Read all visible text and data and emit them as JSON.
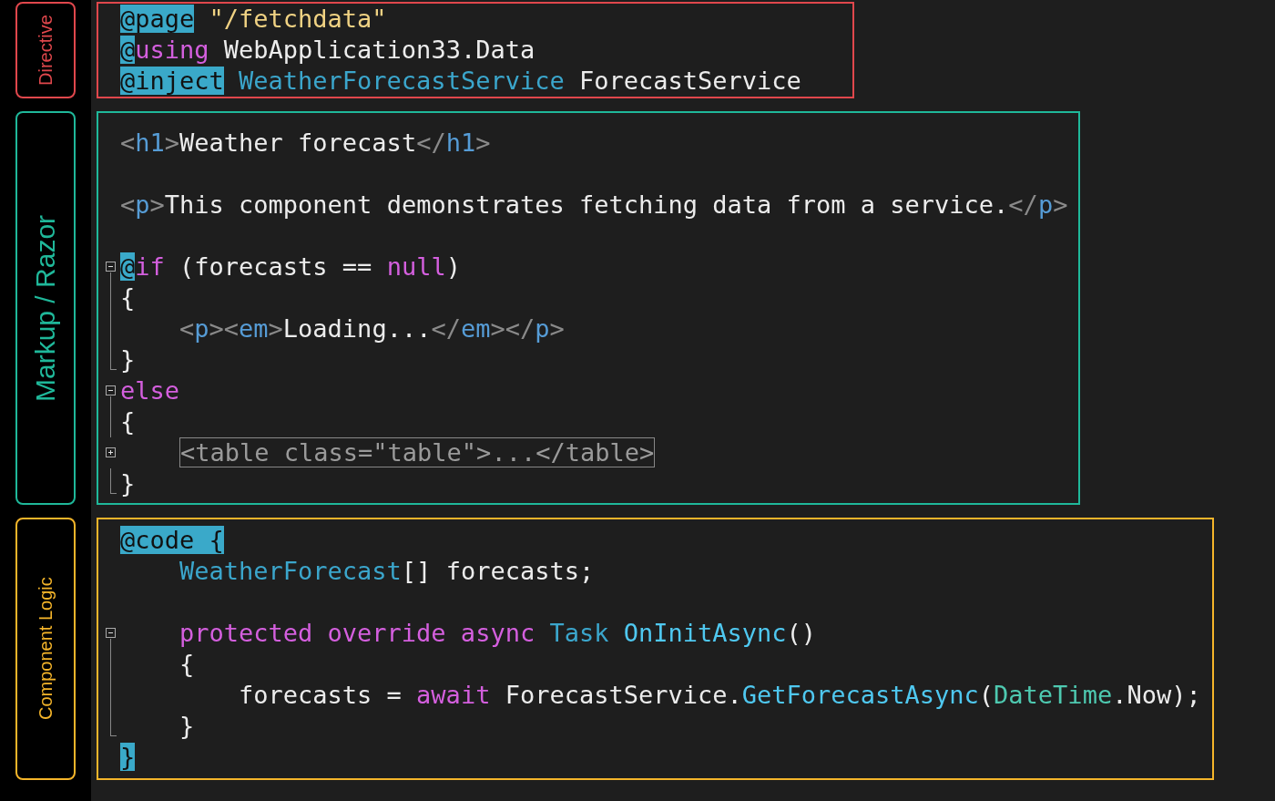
{
  "sections": [
    {
      "label": "Directive",
      "kind": "directive",
      "color": "#e0474c",
      "lines": [
        {
          "kind": "plain",
          "tokens": [
            {
              "kind": "razor",
              "text": "@page"
            },
            {
              "kind": "string",
              "text": " \"/fetchdata\""
            }
          ]
        },
        {
          "kind": "plain",
          "tokens": [
            {
              "kind": "razor",
              "text": "@"
            },
            {
              "kind": "keyword",
              "text": "using"
            },
            {
              "kind": "text",
              "text": " WebApplication33.Data"
            }
          ]
        },
        {
          "kind": "plain",
          "tokens": [
            {
              "kind": "razor",
              "text": "@inject"
            },
            {
              "kind": "type",
              "text": " WeatherForecastService"
            },
            {
              "kind": "text",
              "text": " ForecastService"
            }
          ]
        }
      ]
    },
    {
      "label": "Markup / Razor",
      "kind": "markup",
      "color": "#1fb89a",
      "lines": [
        {
          "kind": "plain",
          "tokens": [
            {
              "kind": "punct",
              "text": "<"
            },
            {
              "kind": "tag",
              "text": "h1"
            },
            {
              "kind": "punct",
              "text": ">"
            },
            {
              "kind": "text",
              "text": "Weather forecast"
            },
            {
              "kind": "punct",
              "text": "</"
            },
            {
              "kind": "tag",
              "text": "h1"
            },
            {
              "kind": "punct",
              "text": ">"
            }
          ]
        },
        {
          "kind": "blank"
        },
        {
          "kind": "plain",
          "tokens": [
            {
              "kind": "punct",
              "text": "<"
            },
            {
              "kind": "tag",
              "text": "p"
            },
            {
              "kind": "punct",
              "text": ">"
            },
            {
              "kind": "text",
              "text": "This component demonstrates fetching data from a service."
            },
            {
              "kind": "punct",
              "text": "</"
            },
            {
              "kind": "tag",
              "text": "p"
            },
            {
              "kind": "punct",
              "text": ">"
            }
          ]
        },
        {
          "kind": "blank"
        },
        {
          "kind": "fold_start",
          "tokens": [
            {
              "kind": "razor",
              "text": "@"
            },
            {
              "kind": "keyword",
              "text": "if"
            },
            {
              "kind": "text",
              "text": " (forecasts == "
            },
            {
              "kind": "keyword",
              "text": "null"
            },
            {
              "kind": "text",
              "text": ")"
            }
          ]
        },
        {
          "kind": "fold_body",
          "tokens": [
            {
              "kind": "text",
              "text": "{"
            }
          ]
        },
        {
          "kind": "fold_body",
          "tokens": [
            {
              "kind": "punct",
              "text": "    <"
            },
            {
              "kind": "tag",
              "text": "p"
            },
            {
              "kind": "punct",
              "text": "><"
            },
            {
              "kind": "tag",
              "text": "em"
            },
            {
              "kind": "punct",
              "text": ">"
            },
            {
              "kind": "text",
              "text": "Loading..."
            },
            {
              "kind": "punct",
              "text": "</"
            },
            {
              "kind": "tag",
              "text": "em"
            },
            {
              "kind": "punct",
              "text": "></"
            },
            {
              "kind": "tag",
              "text": "p"
            },
            {
              "kind": "punct",
              "text": ">"
            }
          ]
        },
        {
          "kind": "fold_end",
          "tokens": [
            {
              "kind": "text",
              "text": "}"
            }
          ]
        },
        {
          "kind": "fold_start",
          "tokens": [
            {
              "kind": "keyword",
              "text": "else"
            }
          ]
        },
        {
          "kind": "fold_body",
          "tokens": [
            {
              "kind": "text",
              "text": "{"
            }
          ]
        },
        {
          "kind": "folded",
          "tokens": [
            {
              "kind": "collapsed",
              "text": "<table class=\"table\">...</table>"
            }
          ]
        },
        {
          "kind": "fold_end",
          "tokens": [
            {
              "kind": "text",
              "text": "}"
            }
          ]
        }
      ]
    },
    {
      "label": "Component Logic",
      "kind": "logic",
      "color": "#f5b52a",
      "lines": [
        {
          "kind": "plain",
          "tokens": [
            {
              "kind": "razor",
              "text": "@code"
            },
            {
              "kind": "razor",
              "text": " {"
            }
          ]
        },
        {
          "kind": "plain",
          "tokens": [
            {
              "kind": "type",
              "text": "    WeatherForecast"
            },
            {
              "kind": "text",
              "text": "[] forecasts;"
            }
          ]
        },
        {
          "kind": "blank"
        },
        {
          "kind": "fold_start",
          "tokens": [
            {
              "kind": "keyword",
              "text": "    protected override async "
            },
            {
              "kind": "type",
              "text": "Task "
            },
            {
              "kind": "method",
              "text": "OnInitAsync"
            },
            {
              "kind": "text",
              "text": "()"
            }
          ]
        },
        {
          "kind": "fold_body",
          "tokens": [
            {
              "kind": "text",
              "text": "    {"
            }
          ]
        },
        {
          "kind": "fold_body",
          "tokens": [
            {
              "kind": "text",
              "text": "        forecasts = "
            },
            {
              "kind": "keyword",
              "text": "await"
            },
            {
              "kind": "text",
              "text": " ForecastService."
            },
            {
              "kind": "method",
              "text": "GetForecastAsync"
            },
            {
              "kind": "text",
              "text": "("
            },
            {
              "kind": "class",
              "text": "DateTime"
            },
            {
              "kind": "text",
              "text": ".Now);"
            }
          ]
        },
        {
          "kind": "fold_end",
          "tokens": [
            {
              "kind": "text",
              "text": "    }"
            }
          ]
        },
        {
          "kind": "plain",
          "tokens": [
            {
              "kind": "razor",
              "text": "}"
            }
          ]
        }
      ]
    }
  ]
}
